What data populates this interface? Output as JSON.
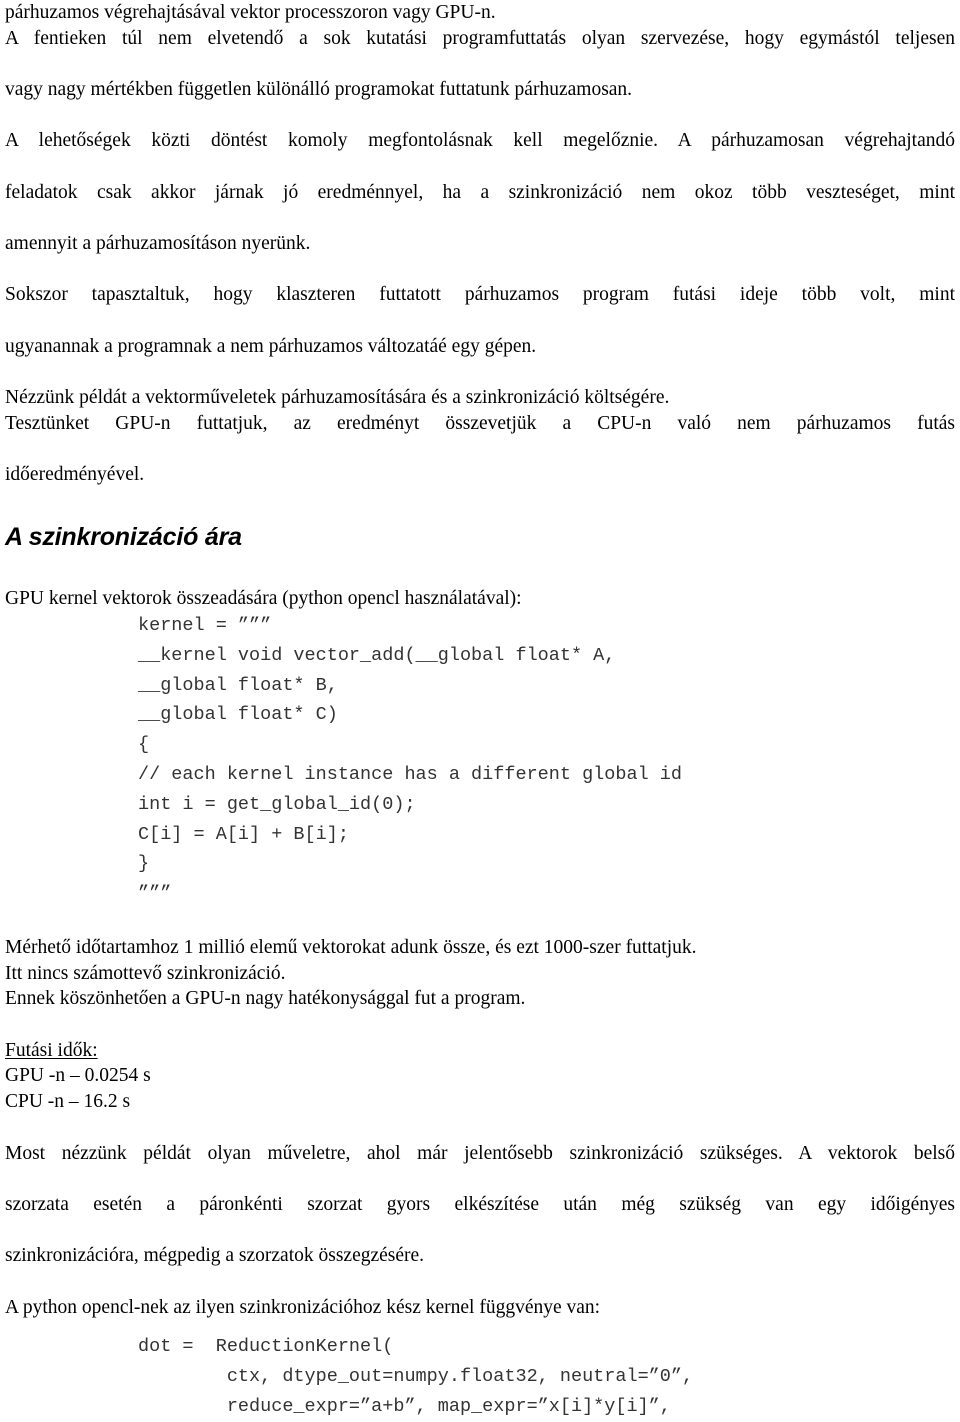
{
  "document": {
    "language": "hu",
    "blocks": {
      "para_intro_lines": [
        "párhuzamos végrehajtásával vektor processzoron vagy GPU-n.",
        "A fentieken túl nem elvetendő a sok kutatási programfuttatás olyan szervezése, hogy egymástól teljesen",
        "vagy nagy mértékben független különálló programokat futtatunk párhuzamosan."
      ],
      "para_decision_lines": [
        "A lehetőségek közti döntést komoly megfontolásnak kell megelőznie. A párhuzamosan végrehajtandó",
        "feladatok csak akkor járnak jó eredménnyel, ha a szinkronizáció nem okoz több veszteséget, mint",
        "amennyit a párhuzamosításon nyerünk."
      ],
      "para_experience_lines": [
        "Sokszor tapasztaltuk, hogy klaszteren futtatott párhuzamos program futási ideje több volt, mint",
        "ugyanannak a programnak a nem párhuzamos változatáé egy gépen."
      ],
      "para_example_lines": [
        "Nézzünk példát a vektorműveletek párhuzamosítására és a szinkronizáció költségére.",
        "Tesztünket GPU-n futtatjuk, az eredményt összevetjük a CPU-n való nem párhuzamos futás",
        "időeredményével."
      ],
      "heading_sync_cost": "A szinkronizáció ára",
      "caption_gpu_kernel": "GPU kernel vektorok összeadására (python opencl használatával):",
      "code_vector_add_lines": [
        "kernel = ”””",
        "__kernel void vector_add(__global float* A,",
        "__global float* B,",
        "__global float* C)",
        "{",
        "// each kernel instance has a different global id",
        "int i = get_global_id(0);",
        "C[i] = A[i] + B[i];",
        "}",
        "”””"
      ],
      "para_measure_lines": [
        "Mérhető időtartamhoz 1 millió elemű vektorokat adunk össze, és ezt 1000-szer futtatjuk.",
        "Itt nincs számottevő szinkronizáció.",
        "Ennek köszönhetően a GPU-n nagy hatékonysággal fut a program."
      ],
      "runtimes_label": "Futási idők:",
      "runtimes_lines": [
        "GPU -n – 0.0254 s",
        "CPU -n – 16.2 s"
      ],
      "para_dotproduct_lines": [
        "Most nézzünk példát olyan műveletre, ahol már jelentősebb szinkronizáció szükséges. A vektorok belső",
        "szorzata esetén a páronkénti szorzat gyors elkészítése után még szükség van egy időigényes",
        "szinkronizációra, mégpedig a szorzatok összegzésére."
      ],
      "caption_reduction": "A python opencl-nek az ilyen szinkronizációhoz kész kernel függvénye van:",
      "code_reduction_lines": [
        "dot =  ReductionKernel(",
        "        ctx, dtype_out=numpy.float32, neutral=”0”,",
        "        reduce_expr=”a+b”, map_expr=”x[i]*y[i]”,"
      ]
    },
    "colors": {
      "text": "#000000",
      "code_text": "#333333",
      "background": "#ffffff"
    }
  }
}
